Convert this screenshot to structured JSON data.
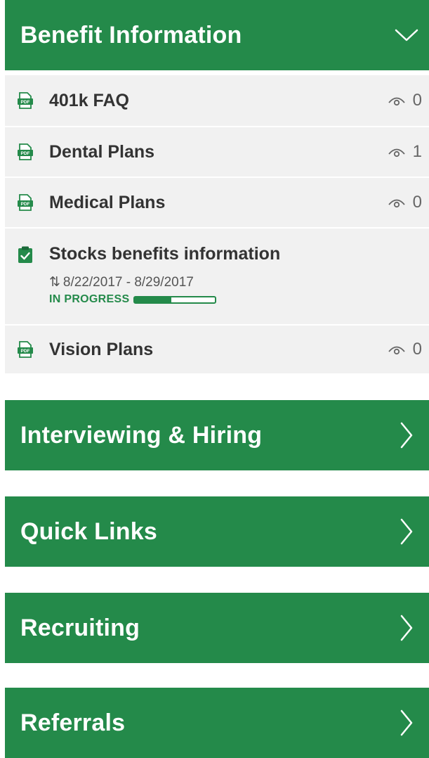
{
  "colors": {
    "brand_green": "#248a4a",
    "list_bg": "#f1f1f1",
    "text_dark": "#333333"
  },
  "benefit_section": {
    "title": "Benefit Information",
    "state": "expanded",
    "chevron_icon": "chevron-down-icon",
    "items": [
      {
        "title": "401k FAQ",
        "icon": "pdf-icon",
        "views": "0"
      },
      {
        "title": "Dental Plans",
        "icon": "pdf-icon",
        "views": "1"
      },
      {
        "title": "Medical Plans",
        "icon": "pdf-icon",
        "views": "0"
      },
      {
        "title": "Stocks benefits information",
        "icon": "clipboard-check-icon",
        "dates": "8/22/2017 - 8/29/2017",
        "status": "IN PROGRESS",
        "progress": 0.45
      },
      {
        "title": "Vision Plans",
        "icon": "pdf-icon",
        "views": "0"
      }
    ]
  },
  "sections": [
    {
      "title": "Interviewing & Hiring",
      "chevron_icon": "chevron-right-icon"
    },
    {
      "title": "Quick Links",
      "chevron_icon": "chevron-right-icon"
    },
    {
      "title": "Recruiting",
      "chevron_icon": "chevron-right-icon"
    },
    {
      "title": "Referrals",
      "chevron_icon": "chevron-right-icon"
    }
  ]
}
